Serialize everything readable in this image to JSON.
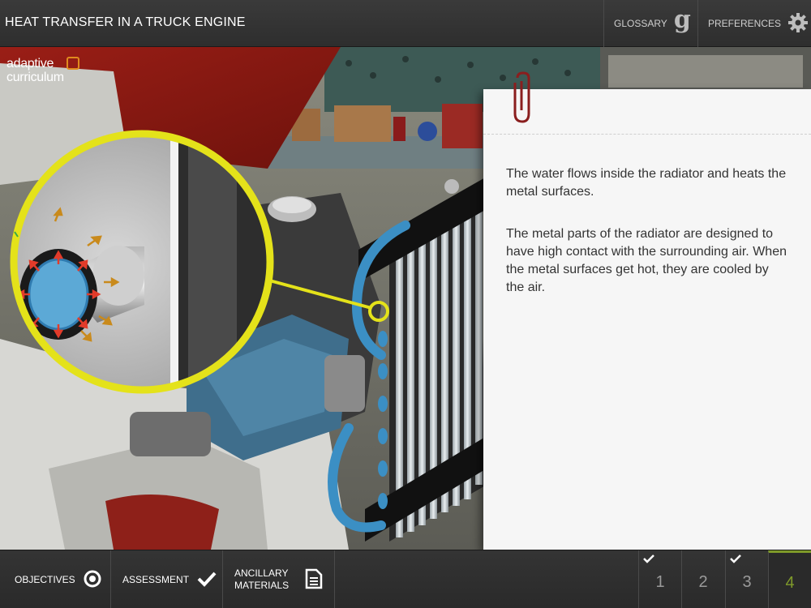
{
  "header": {
    "title": "HEAT TRANSFER IN A TRUCK ENGINE",
    "glossary_label": "GLOSSARY",
    "glossary_icon": "g",
    "preferences_label": "PREFERENCES"
  },
  "logo": {
    "line1": "adaptive",
    "line2": "curriculum"
  },
  "note": {
    "paragraph1": "The water flows inside the radiator and heats the metal surfaces.",
    "paragraph2": "The metal parts of the radiator are designed to have high contact with the surrounding air. When the metal surfaces get hot, they are cooled by the air."
  },
  "footer": {
    "objectives_label": "OBJECTIVES",
    "assessment_label": "ASSESSMENT",
    "ancillary_label": "ANCILLARY MATERIALS",
    "pages": [
      {
        "label": "1",
        "checked": true,
        "current": false
      },
      {
        "label": "2",
        "checked": false,
        "current": false
      },
      {
        "label": "3",
        "checked": true,
        "current": false
      },
      {
        "label": "4",
        "checked": false,
        "current": true
      }
    ]
  },
  "colors": {
    "accent": "#7f9a2a",
    "highlight_ring": "#e4e21a",
    "pipe_blue": "#3b8fc4",
    "engine_blue": "#3f6e8c"
  }
}
